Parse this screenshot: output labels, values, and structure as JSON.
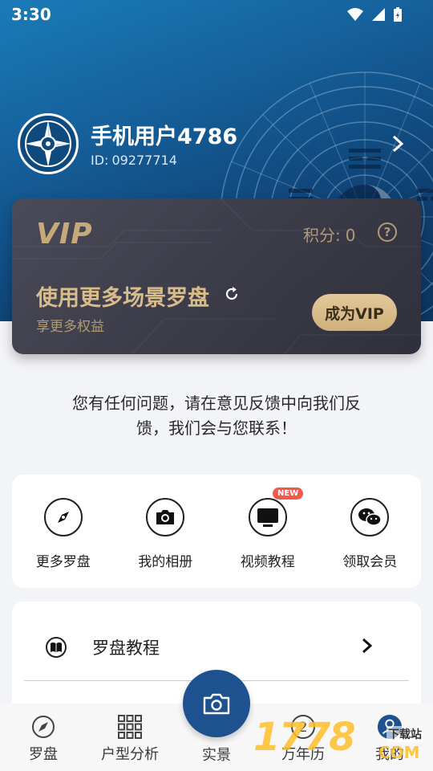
{
  "status_bar": {
    "time": "3:30"
  },
  "profile": {
    "name": "手机用户4786",
    "id_prefix": "ID:",
    "id_value": "09277714"
  },
  "vip_card": {
    "logo": "VIP",
    "points_label": "积分:",
    "points_value": "0",
    "help": "?",
    "title": "使用更多场景罗盘",
    "subtitle": "享更多权益",
    "cta": "成为VIP"
  },
  "feedback": {
    "line1": "您有任何问题，请在意见反馈中向我们反",
    "line2": "馈，我们会与您联系！"
  },
  "quick_actions": [
    {
      "label": "更多罗盘",
      "icon": "compass-icon"
    },
    {
      "label": "我的相册",
      "icon": "camera-icon"
    },
    {
      "label": "视频教程",
      "icon": "tv-icon",
      "badge": "NEW"
    },
    {
      "label": "领取会员",
      "icon": "wechat-icon"
    }
  ],
  "menu": [
    {
      "label": "罗盘教程",
      "icon": "book-icon"
    }
  ],
  "tabs": [
    {
      "label": "罗盘",
      "icon": "compass-icon"
    },
    {
      "label": "户型分析",
      "icon": "grid-icon"
    },
    {
      "label": "实景",
      "icon": "camera-icon"
    },
    {
      "label": "万年历",
      "icon": "calendar-icon"
    },
    {
      "label": "我的",
      "icon": "user-icon"
    }
  ],
  "watermark": {
    "digits": "1778",
    "com": "COM",
    "sub": "下载站"
  },
  "colors": {
    "hero": "#155f9a",
    "accent": "#1e5190",
    "gold": "#d8bd8b",
    "badge": "#f05a4a"
  }
}
